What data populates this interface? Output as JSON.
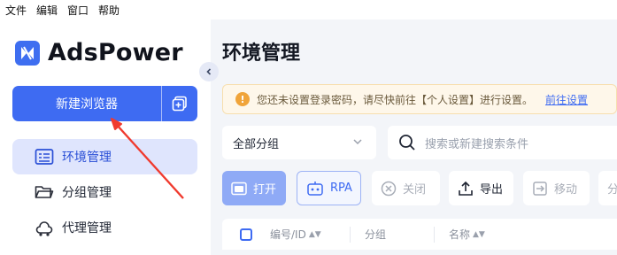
{
  "menubar": [
    "文件",
    "编辑",
    "窗口",
    "帮助"
  ],
  "app": {
    "name": "AdsPower"
  },
  "sidebar": {
    "new_browser": "新建浏览器",
    "items": [
      {
        "label": "环境管理",
        "active": true
      },
      {
        "label": "分组管理",
        "active": false
      },
      {
        "label": "代理管理",
        "active": false
      }
    ]
  },
  "main": {
    "title": "环境管理",
    "warning": {
      "text": "您还未设置登录密码，请尽快前往【个人设置】进行设置。",
      "link": "前往设置"
    },
    "group_select": "全部分组",
    "search_placeholder": "搜索或新建搜索条件",
    "toolbar": {
      "open": "打开",
      "rpa": "RPA",
      "close": "关闭",
      "export": "导出",
      "move": "移动",
      "partial": "分"
    },
    "table": {
      "columns": [
        "编号/ID",
        "分组",
        "名称"
      ]
    }
  },
  "colors": {
    "accent": "#3e6bf2",
    "warning": "#f0a43a",
    "arrow": "#f03a2e"
  }
}
